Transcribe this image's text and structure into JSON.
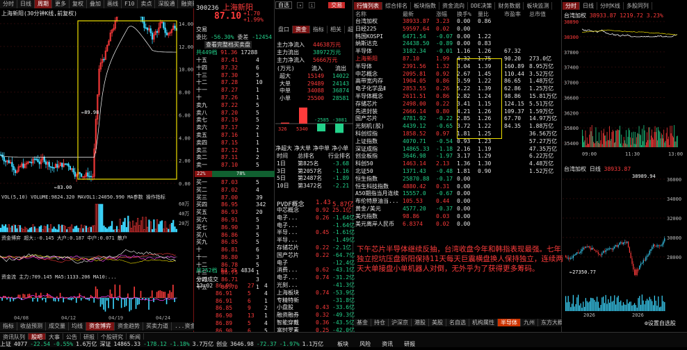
{
  "colors": {
    "up": "#ff3b3b",
    "down": "#23d28b",
    "highlight": "#f0e000",
    "box": "#f0e000"
  },
  "chart_panel": {
    "top_tabs": [
      "分时",
      "日线",
      "周期",
      "更多",
      "复权",
      "叠加",
      "画线",
      "F10",
      "卖点",
      "深股通",
      "融资融券",
      "更多功能"
    ],
    "title": "上海新阳(30分钟K线,前复权)",
    "price_axis": [
      "14.00",
      "12.00",
      "10.00",
      "8.00",
      "6.00",
      "4.00",
      "2.00",
      "0.00"
    ],
    "high_label": "89.98",
    "low_label": "83.00",
    "vol_header": "VOL(5,10) VOLUME:9824.320 MAVOL1:24050.990 MA参数 操作指标",
    "vol_axis": [
      "60万",
      "40万",
      "20万"
    ],
    "capital_header": "资金博弈 超大:-0.145 大户:0.187 中户:0.071 散户",
    "capital_header2": "资金流 主力:709.145 MA5:1133.206 MA10:...",
    "date_labels": [
      "04/08",
      "04/12",
      "04/19",
      "04/24"
    ],
    "bottom_tabs": [
      "指标",
      "收益预测",
      "成交量",
      "均线",
      "资金博弈",
      "资金趋势",
      "买卖力道",
      "...资金"
    ],
    "sub_tabs": [
      "资讯队列",
      "股吧",
      "大事",
      "公告",
      "研报",
      "个股研究",
      "新闻"
    ]
  },
  "quote_panel": {
    "code": "300236",
    "name": "上海新阳",
    "price": "87.10",
    "chg": "+1.70",
    "pct": "+1.99%",
    "btn_watch": "自选",
    "btn_trade": "交易",
    "stats": [
      [
        "委比",
        "-56.30%",
        "委差",
        "-12454"
      ],
      [
        "成交",
        "",
        "交易手",
        ""
      ]
    ],
    "link": "查看完整档买卖盘",
    "total_label": "共449档",
    "total_price": "91.36",
    "total_qty": "17288",
    "sell_levels": [
      [
        "十五",
        "87.41",
        "4"
      ],
      [
        "十四",
        "87.32",
        "6"
      ],
      [
        "十三",
        "87.30",
        "5"
      ],
      [
        "十二",
        "87.28",
        "10"
      ],
      [
        "十一",
        "87.27",
        "1"
      ],
      [
        "十",
        "87.26",
        "1"
      ],
      [
        "卖九",
        "87.22",
        "5"
      ],
      [
        "卖八",
        "87.20",
        "5"
      ],
      [
        "卖七",
        "87.19",
        "5"
      ],
      [
        "卖六",
        "87.17",
        "2"
      ],
      [
        "卖五",
        "87.16",
        "1"
      ],
      [
        "卖四",
        "87.15",
        "1"
      ],
      [
        "卖三",
        "87.12",
        "1"
      ],
      [
        "卖二",
        "87.11",
        "2"
      ],
      [
        "卖一",
        "87.10",
        "5"
      ]
    ],
    "buy_levels": [
      [
        "买一",
        "87.03",
        "5"
      ],
      [
        "买二",
        "87.02",
        "4"
      ],
      [
        "买三",
        "87.00",
        "39"
      ],
      [
        "买四",
        "86.95",
        "342"
      ],
      [
        "买五",
        "86.93",
        "20"
      ],
      [
        "买六",
        "86.91",
        "5"
      ],
      [
        "买七",
        "86.90",
        "3"
      ],
      [
        "买八",
        "86.86",
        "5"
      ],
      [
        "买九",
        "86.85",
        "5"
      ],
      [
        "十",
        "86.81",
        "6"
      ],
      [
        "十一",
        "86.80",
        "3"
      ],
      [
        "十二",
        "86.78",
        "5"
      ],
      [
        "十三",
        "86.75",
        "1"
      ],
      [
        "十四",
        "86.71",
        "3"
      ],
      [
        "十五",
        "86.70",
        "1"
      ]
    ],
    "buy_total_label": "共252档",
    "buy_total_price": "84.25",
    "buy_total_qty": "4834",
    "ratio_left": "22%",
    "ratio_right": "78%",
    "tick_header": "分时成交",
    "ticks": [
      [
        "13:02",
        "86.90",
        "27",
        "4"
      ],
      [
        "",
        "86.91",
        "5",
        "4"
      ],
      [
        "",
        "86.91",
        "6",
        "1"
      ],
      [
        "",
        "86.85",
        "9",
        "2"
      ],
      [
        "",
        "86.90",
        "13",
        "1"
      ],
      [
        "",
        "86.89",
        "5",
        "4"
      ],
      [
        "",
        "86.90",
        "6",
        "5"
      ],
      [
        "",
        "87.05",
        "4",
        "1"
      ],
      [
        "",
        "87.06",
        "5",
        "2"
      ]
    ]
  },
  "flow_panel": {
    "tabs": [
      "盘口",
      "资金",
      "指标",
      "相关",
      "超额",
      "速览"
    ],
    "main_flows": [
      [
        "主力净流入",
        "44638万元"
      ],
      [
        "主力流出",
        "38972万元"
      ],
      [
        "主力净流入",
        "5666万元"
      ]
    ],
    "unit": "(万元)",
    "col_in": "流入",
    "col_out": "流出",
    "rows": [
      [
        "超大",
        "15149",
        "14022"
      ],
      [
        "大单",
        "29489",
        "24143"
      ],
      [
        "中单",
        "34088",
        "36874"
      ],
      [
        "小单",
        "25500",
        "28581"
      ]
    ],
    "bar_vals": [
      "326",
      "5340",
      "-2585",
      "-3081"
    ],
    "net_labels": [
      "净超大",
      "净大单",
      "净中单",
      "净小单"
    ],
    "rank_header": [
      "时间",
      "总排名",
      "行业排名"
    ],
    "rank_rows": [
      [
        "1日",
        "第825名",
        "-3.68"
      ],
      [
        "3日",
        "第2057名",
        "-1.16"
      ],
      [
        "5日",
        "第2487名",
        "-1.89"
      ],
      [
        "10日",
        "第3472名",
        "-2.21"
      ]
    ],
    "related_header": [
      "PVDF概念",
      "1.43",
      "5.87亿"
    ],
    "related": [
      [
        "中芯概念",
        "0.92",
        "25.1亿"
      ],
      [
        "电子...",
        "0.26",
        "-1.64亿"
      ],
      [
        "电子...",
        "",
        "-1.64亿"
      ],
      [
        "半导...",
        "0.45",
        "-1.61亿"
      ],
      [
        "半导...",
        "",
        "-1.49亿"
      ],
      [
        "存储芯片",
        "0.22",
        "-2.1亿"
      ],
      [
        "国产芯片",
        "0.22",
        "-64.7亿"
      ],
      [
        "电子",
        "",
        "-12.4亿"
      ],
      [
        "消费...",
        "0.62",
        "-43.1亿"
      ],
      [
        "电子...",
        "0.74",
        "-31.2亿"
      ],
      [
        "光刻...",
        "",
        "-41.3亿"
      ],
      [
        "上海板块",
        "0.74",
        "-53.9亿"
      ],
      [
        "专精特新",
        "",
        "-31.8亿"
      ],
      [
        "小盘股",
        "0.43",
        "-33.6亿"
      ],
      [
        "融资融券",
        "0.32",
        "-49.3亿"
      ],
      [
        "智能穿戴",
        "0.36",
        "-43.5亿"
      ],
      [
        "富时罗素",
        "0.25",
        "-42.0亿"
      ],
      [
        "创业板综",
        "0.43",
        "-26.2亿"
      ]
    ]
  },
  "market_panel": {
    "tabs": [
      "行情列表",
      "综合排名",
      "板块指数",
      "资金流向",
      "DDE决策",
      "财务数据",
      "板块监测"
    ],
    "columns": [
      "名称",
      "最新",
      "涨幅",
      "换手%",
      "量比",
      "市盈率",
      "总市值"
    ],
    "rows": [
      [
        "台湾加权",
        "38933.87",
        "3.23",
        "0.00",
        "0.86",
        "",
        ""
      ],
      [
        "日经225",
        "59597.64",
        "0.02",
        "0.00",
        "",
        "",
        ""
      ],
      [
        "韩国KOSPI",
        "6471.54",
        "-0.07",
        "0.00",
        "1.22",
        "",
        ""
      ],
      [
        "纳斯达克",
        "24438.50",
        "-0.89",
        "0.00",
        "0.83",
        "",
        ""
      ],
      [
        "半导体",
        "3182.34",
        "-0.01",
        "1.16",
        "1.26",
        "67.32",
        ""
      ],
      [
        "上海新阳",
        "87.10",
        "1.99",
        "4.32",
        "1.75",
        "90.20",
        "273.0亿"
      ],
      [
        "半导体",
        "2391.56",
        "1.32",
        "3.04",
        "1.39",
        "160.89",
        "8.95万亿"
      ],
      [
        "中芯概念",
        "2095.81",
        "0.92",
        "2.67",
        "1.45",
        "110.44",
        "3.52万亿"
      ],
      [
        "高带宽内存",
        "1904.05",
        "0.86",
        "3.59",
        "1.22",
        "86.65",
        "1.48万亿"
      ],
      [
        "电子化学品Ⅱ",
        "2853.55",
        "0.26",
        "5.22",
        "1.39",
        "62.86",
        "1.25万亿"
      ],
      [
        "半导体概念",
        "2611.51",
        "0.86",
        "2.82",
        "1.24",
        "98.86",
        "15.81万亿"
      ],
      [
        "存储芯片",
        "2498.00",
        "0.22",
        "3.41",
        "1.15",
        "124.15",
        "5.51万亿"
      ],
      [
        "先进封装",
        "2666.14",
        "0.80",
        "4.21",
        "1.26",
        "109.37",
        "1.59万亿"
      ],
      [
        "国产芯片",
        "4781.92",
        "-0.22",
        "2.85",
        "1.26",
        "67.70",
        "14.97万亿"
      ],
      [
        "光刻机(胶)",
        "4439.12",
        "-0.65",
        "3.72",
        "1.22",
        "84.35",
        "1.88万亿"
      ],
      [
        "科创综指",
        "1858.52",
        "0.97",
        "1.81",
        "1.25",
        "",
        "36.56万亿"
      ],
      [
        "上证指数",
        "4070.71",
        "-0.54",
        "0.93",
        "1.23",
        "",
        "57.27万亿"
      ],
      [
        "深证成指",
        "14865.33",
        "-1.18",
        "2.16",
        "1.19",
        "",
        "47.35万亿"
      ],
      [
        "创业板指",
        "3646.98",
        "-1.97",
        "3.17",
        "1.29",
        "",
        "6.22万亿"
      ],
      [
        "科创50",
        "1463.14",
        "2.13",
        "1.36",
        "1.30",
        "",
        "4.48万亿"
      ],
      [
        "北证50",
        "1371.43",
        "-0.48",
        "1.81",
        "0.90",
        "",
        "1.52万亿"
      ],
      [
        "恒生指数",
        "25870.88",
        "-0.17",
        "0.00",
        "",
        "",
        ""
      ],
      [
        "恒生科技指数",
        "4880.42",
        "0.31",
        "0.00",
        "",
        "",
        ""
      ],
      [
        "A50期指当月连续",
        "15557.0",
        "-0.67",
        "0.00",
        "",
        "",
        ""
      ],
      [
        "布伦特原油当...",
        "105.53",
        "0.44",
        "0.00",
        "",
        "",
        ""
      ],
      [
        "黄金/美元",
        "4577.20",
        "-0.37",
        "0.00",
        "",
        "",
        ""
      ],
      [
        "美元指数",
        "98.86",
        "0.03",
        "0.00",
        "",
        "",
        ""
      ],
      [
        "美元离岸人民币",
        "6.8374",
        "0.02",
        "0.00",
        "",
        "",
        ""
      ]
    ],
    "commentary": "下午芯片半导体继续反抽，台湾收盘今年和韩指表现最强。七年独立挖坑压盘新阳保持11天每天巨震横盘换人保持独立，连续两天大单接盘小单机器人对倒，无外乎为了获得更多筹码。",
    "bottom_tabs": [
      "基金",
      "持仓",
      "沪深京",
      "港股",
      "美股",
      "名自选",
      "机构属性",
      "半导体",
      "九州",
      "东方大概念",
      "信息",
      "持股",
      "量化",
      "填牛机会在..."
    ]
  },
  "index_panel": {
    "tabs": [
      "分时",
      "日线",
      "分时K线",
      "多股同列"
    ],
    "title": "台湾加权",
    "value": "38933.87",
    "chg": "1219.72",
    "pct": "3.23%",
    "axis": [
      "38890",
      "38300",
      "37800",
      "37400",
      "37000",
      "36600",
      "36200",
      "35800",
      "35400"
    ],
    "times": [
      "09:00",
      "11:30",
      "13:00"
    ],
    "day_title": "台湾加权 日线",
    "day_value": "38933.87",
    "day_axis": [
      "36000",
      "34000",
      "32000",
      "30000",
      "28000"
    ],
    "day_low": "27350.77",
    "day_high": "38989.94",
    "year_labels": [
      "2026",
      "2026"
    ],
    "settings": "设置自选股"
  },
  "status_bar": {
    "left": [
      [
        "上证",
        "4077",
        "-22.54",
        "-0.55%",
        "1.6万亿"
      ],
      [
        "深证",
        "14865.33",
        "-178.12",
        "-1.18%",
        "3.7万亿"
      ],
      [
        "创业",
        "3646.98",
        "-72.37",
        "-1.97%",
        "1.1万亿"
      ]
    ],
    "items": [
      "板块",
      "风险",
      "资讯",
      "研报"
    ]
  }
}
